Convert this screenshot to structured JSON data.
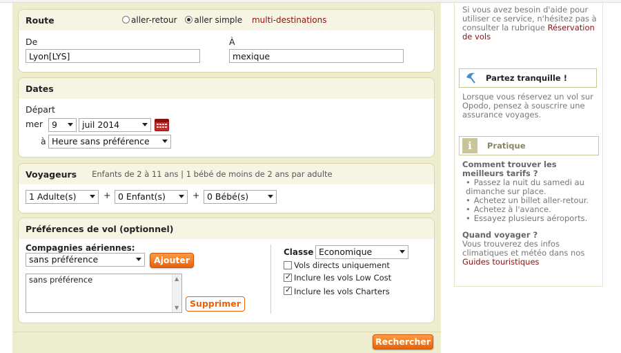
{
  "route": {
    "title": "Route",
    "opt_roundtrip": "aller-retour",
    "opt_oneway": "aller simple",
    "opt_multi": "multi-destinations",
    "from_label": "De",
    "from_value": "Lyon[LYS]",
    "to_label": "À",
    "to_value": "mexique"
  },
  "dates": {
    "title": "Dates",
    "depart_label": "Départ",
    "weekday": "mer",
    "day": "9",
    "month": "juil 2014",
    "at_label": "à",
    "time": "Heure sans préférence"
  },
  "travellers": {
    "title": "Voyageurs",
    "note": "Enfants de 2 à 11 ans | 1 bébé de moins de 2 ans par adulte",
    "adults": "1 Adulte(s)",
    "children": "0 Enfant(s)",
    "babies": "0 Bébé(s)",
    "plus": "+"
  },
  "prefs": {
    "title": "Préférences de vol (optionnel)",
    "airlines_label": "Compagnies aériennes:",
    "airline_select": "sans préférence",
    "add_button": "Ajouter",
    "airline_list_item": "sans préférence",
    "remove_button": "Supprimer",
    "class_label": "Classe",
    "class_value": "Economique",
    "opt_direct": "Vols directs uniquement",
    "opt_lowcost": "Inclure les vols Low Cost",
    "opt_charters": "Inclure les vols Charters"
  },
  "search_button": "Rechercher",
  "sidebar": {
    "help_text": "Si vous avez besoin d'aide pour utiliser ce service, n'hésitez pas à consulter la rubrique",
    "help_link": "Réservation de vols",
    "insurance_title": "Partez tranquille !",
    "insurance_text": "Lorsque vous réservez un vol sur Opodo, pensez à souscrire une assurance voyages.",
    "practical_title": "Pratique",
    "tips_title": "Comment trouver les meilleurs tarifs ?",
    "tips": [
      "Passez la nuit du samedi au dimanche sur place.",
      "Achetez un billet aller-retour.",
      "Achetez à l'avance.",
      "Essayez plusieurs aéroports."
    ],
    "when_title": "Quand voyager ?",
    "when_text": "Vous trouverez des infos climatiques et météo dans nos",
    "when_link": "Guides touristiques"
  },
  "colors": {
    "panel_bg": "#efedcf",
    "accent_orange": "#e8620a",
    "link_red": "#8b1010"
  }
}
